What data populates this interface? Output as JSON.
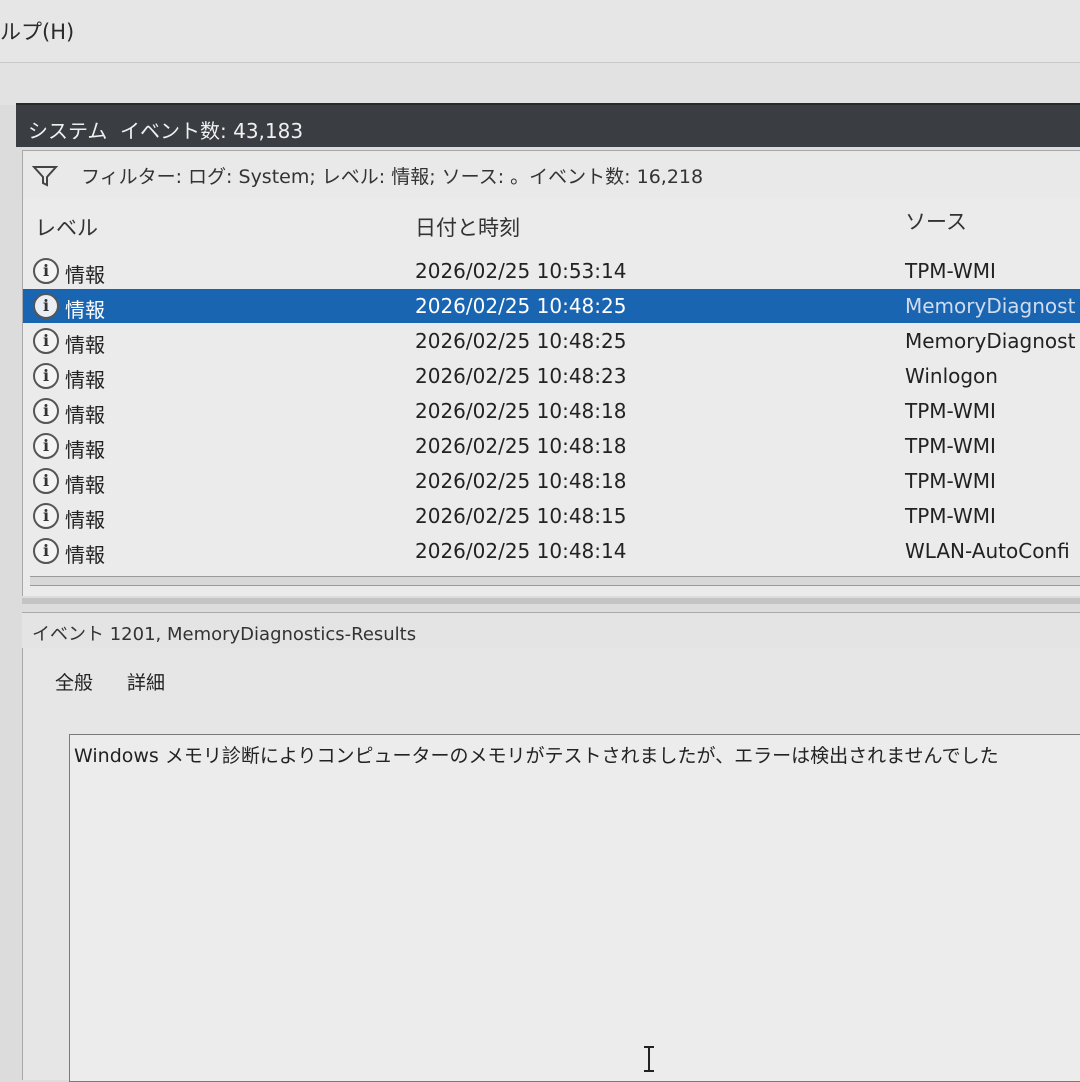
{
  "menu": {
    "help_label": "ルプ(H)"
  },
  "pane": {
    "log_name": "システム",
    "event_count": "イベント数: 43,183"
  },
  "filter": {
    "icon": "funnel-icon",
    "text": "フィルター: ログ: System; レベル: 情報; ソース: 。イベント数: 16,218"
  },
  "columns": {
    "level": "レベル",
    "date": "日付と時刻",
    "source": "ソース"
  },
  "events": [
    {
      "level": "情報",
      "date": "2026/02/25 10:53:14",
      "source": "TPM-WMI"
    },
    {
      "level": "情報",
      "date": "2026/02/25 10:48:25",
      "source": "MemoryDiagnost",
      "selected": true
    },
    {
      "level": "情報",
      "date": "2026/02/25 10:48:25",
      "source": "MemoryDiagnost"
    },
    {
      "level": "情報",
      "date": "2026/02/25 10:48:23",
      "source": "Winlogon"
    },
    {
      "level": "情報",
      "date": "2026/02/25 10:48:18",
      "source": "TPM-WMI"
    },
    {
      "level": "情報",
      "date": "2026/02/25 10:48:18",
      "source": "TPM-WMI"
    },
    {
      "level": "情報",
      "date": "2026/02/25 10:48:18",
      "source": "TPM-WMI"
    },
    {
      "level": "情報",
      "date": "2026/02/25 10:48:15",
      "source": "TPM-WMI"
    },
    {
      "level": "情報",
      "date": "2026/02/25 10:48:14",
      "source": "WLAN-AutoConfi"
    }
  ],
  "detail": {
    "header": "イベント 1201, MemoryDiagnostics-Results",
    "tabs": {
      "general": "全般",
      "details": "詳細"
    },
    "message": "Windows メモリ診断によりコンピューターのメモリがテストされましたが、エラーは検出されませんでした"
  },
  "colors": {
    "selection": "#1a65b2",
    "title_bar": "#3a3d42"
  }
}
